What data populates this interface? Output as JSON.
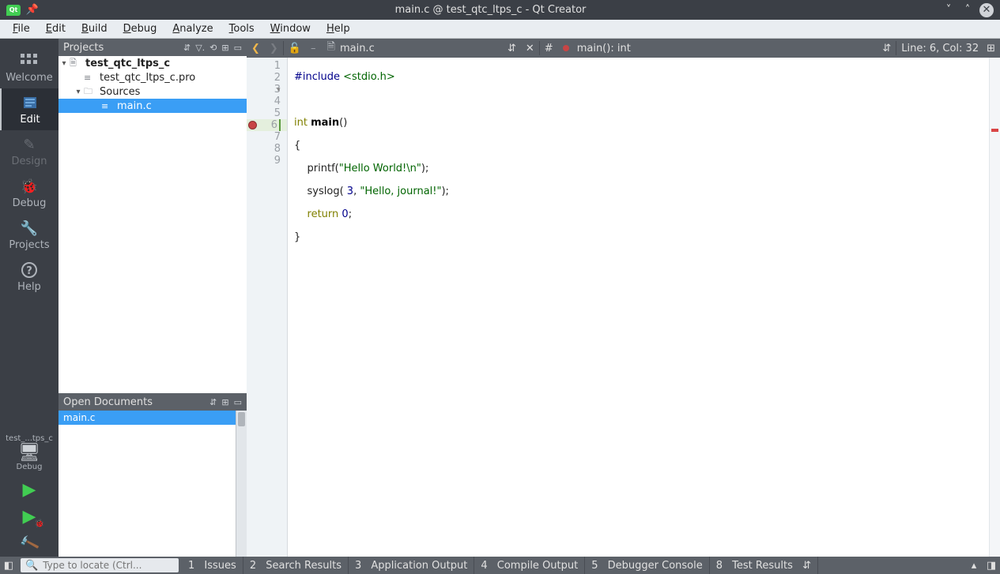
{
  "window": {
    "title": "main.c @ test_qtc_ltps_c - Qt Creator"
  },
  "menus": [
    "File",
    "Edit",
    "Build",
    "Debug",
    "Analyze",
    "Tools",
    "Window",
    "Help"
  ],
  "modes": [
    {
      "key": "welcome",
      "label": "Welcome",
      "active": false
    },
    {
      "key": "edit",
      "label": "Edit",
      "active": true
    },
    {
      "key": "design",
      "label": "Design",
      "active": false,
      "disabled": true
    },
    {
      "key": "debugmode",
      "label": "Debug",
      "active": false
    },
    {
      "key": "projects",
      "label": "Projects",
      "active": false
    },
    {
      "key": "help",
      "label": "Help",
      "active": false
    }
  ],
  "target": {
    "name": "test_...tps_c",
    "config": "Debug"
  },
  "sidebar": {
    "projects_label": "Projects",
    "open_docs_label": "Open Documents",
    "tree": {
      "root": "test_qtc_ltps_c",
      "pro": "test_qtc_ltps_c.pro",
      "sources": "Sources",
      "file": "main.c"
    },
    "open_docs": [
      "main.c"
    ]
  },
  "editor": {
    "filename": "main.c",
    "symbol": "main(): int",
    "position": "Line: 6, Col: 32",
    "lines": [
      {
        "n": 1,
        "pre": "#include ",
        "inc": "<stdio.h>"
      },
      {
        "n": 2,
        "text": ""
      },
      {
        "n": 3,
        "fold": true,
        "type": "int ",
        "fn": "main",
        "tail": "()"
      },
      {
        "n": 4,
        "text": "{"
      },
      {
        "n": 5,
        "indent": "    ",
        "call": "printf(",
        "str": "\"Hello World!\\n\"",
        "tail": ");"
      },
      {
        "n": 6,
        "current": true,
        "bp": true,
        "indent": "    ",
        "call": "syslog( ",
        "num": "3",
        "mid": ", ",
        "str": "\"Hello, journal!\"",
        "tail": ");"
      },
      {
        "n": 7,
        "indent": "    ",
        "ret": "return ",
        "num": "0",
        "tail": ";"
      },
      {
        "n": 8,
        "text": "}"
      },
      {
        "n": 9,
        "text": ""
      }
    ]
  },
  "status": {
    "locate_placeholder": "Type to locate (Ctrl...",
    "panes": [
      {
        "n": "1",
        "label": "Issues"
      },
      {
        "n": "2",
        "label": "Search Results"
      },
      {
        "n": "3",
        "label": "Application Output"
      },
      {
        "n": "4",
        "label": "Compile Output"
      },
      {
        "n": "5",
        "label": "Debugger Console"
      },
      {
        "n": "8",
        "label": "Test Results"
      }
    ]
  }
}
